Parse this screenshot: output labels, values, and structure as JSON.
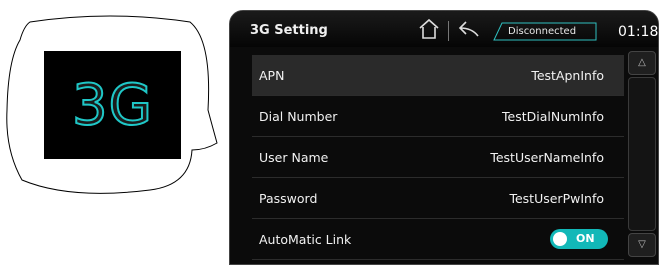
{
  "illustration": {
    "text": "3G"
  },
  "header": {
    "title": "3G Setting",
    "status": "Disconnected",
    "time": "01:18"
  },
  "rows": [
    {
      "label": "APN",
      "value": "TestApnInfo"
    },
    {
      "label": "Dial Number",
      "value": "TestDialNumInfo"
    },
    {
      "label": "User Name",
      "value": "TestUserNameInfo"
    },
    {
      "label": "Password",
      "value": "TestUserPwInfo"
    },
    {
      "label": "AutoMatic Link",
      "toggle": "ON"
    }
  ],
  "scroll": {
    "up_glyph": "△",
    "down_glyph": "▽"
  },
  "colors": {
    "accent": "#12b8b8",
    "background": "#0b0b0b"
  }
}
